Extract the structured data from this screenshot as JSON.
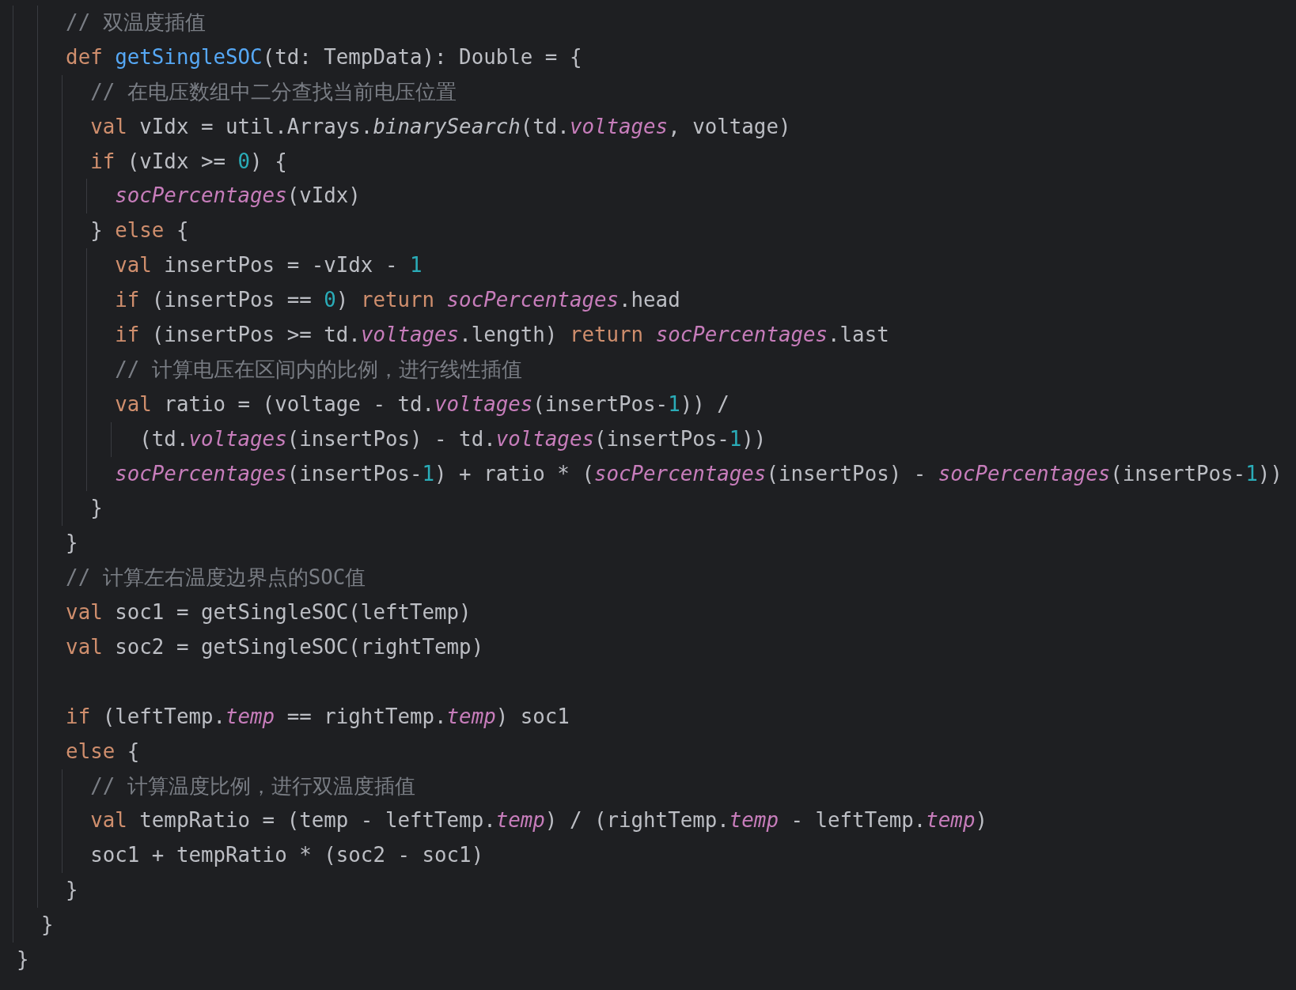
{
  "editor": {
    "lines": [
      {
        "kind": "code",
        "tokens": [
          {
            "text": "    // 双温度插值",
            "kind": "comment"
          }
        ]
      },
      {
        "kind": "code",
        "tokens": [
          {
            "text": "    def ",
            "kind": "keyword"
          },
          {
            "text": "getSingleSOC",
            "kind": "function"
          },
          {
            "text": "(td: TempData): Double = {",
            "kind": "plain"
          }
        ]
      },
      {
        "kind": "code",
        "tokens": [
          {
            "text": "      // 在电压数组中二分查找当前电压位置",
            "kind": "comment"
          }
        ]
      },
      {
        "kind": "code",
        "tokens": [
          {
            "text": "      val",
            "kind": "keyword"
          },
          {
            "text": " vIdx = util.Arrays.",
            "kind": "plain"
          },
          {
            "text": "binarySearch",
            "kind": "static"
          },
          {
            "text": "(td.",
            "kind": "plain"
          },
          {
            "text": "voltages",
            "kind": "field"
          },
          {
            "text": ", voltage)",
            "kind": "plain"
          }
        ]
      },
      {
        "kind": "code",
        "tokens": [
          {
            "text": "      if",
            "kind": "keyword"
          },
          {
            "text": " (vIdx >= ",
            "kind": "plain"
          },
          {
            "text": "0",
            "kind": "number"
          },
          {
            "text": ") {",
            "kind": "plain"
          }
        ]
      },
      {
        "kind": "code",
        "tokens": [
          {
            "text": "        socPercentages",
            "kind": "field"
          },
          {
            "text": "(vIdx)",
            "kind": "plain"
          }
        ]
      },
      {
        "kind": "code",
        "tokens": [
          {
            "text": "      } ",
            "kind": "plain"
          },
          {
            "text": "else",
            "kind": "keyword"
          },
          {
            "text": " {",
            "kind": "plain"
          }
        ]
      },
      {
        "kind": "code",
        "tokens": [
          {
            "text": "        val",
            "kind": "keyword"
          },
          {
            "text": " insertPos = -vIdx - ",
            "kind": "plain"
          },
          {
            "text": "1",
            "kind": "number"
          }
        ]
      },
      {
        "kind": "code",
        "tokens": [
          {
            "text": "        if",
            "kind": "keyword"
          },
          {
            "text": " (insertPos == ",
            "kind": "plain"
          },
          {
            "text": "0",
            "kind": "number"
          },
          {
            "text": ") ",
            "kind": "plain"
          },
          {
            "text": "return ",
            "kind": "keyword"
          },
          {
            "text": "socPercentages",
            "kind": "field"
          },
          {
            "text": ".head",
            "kind": "plain"
          }
        ]
      },
      {
        "kind": "code",
        "tokens": [
          {
            "text": "        if",
            "kind": "keyword"
          },
          {
            "text": " (insertPos >= td.",
            "kind": "plain"
          },
          {
            "text": "voltages",
            "kind": "field"
          },
          {
            "text": ".length) ",
            "kind": "plain"
          },
          {
            "text": "return ",
            "kind": "keyword"
          },
          {
            "text": "socPercentages",
            "kind": "field"
          },
          {
            "text": ".last",
            "kind": "plain"
          }
        ]
      },
      {
        "kind": "code",
        "tokens": [
          {
            "text": "        // 计算电压在区间内的比例，进行线性插值",
            "kind": "comment"
          }
        ]
      },
      {
        "kind": "code",
        "tokens": [
          {
            "text": "        val",
            "kind": "keyword"
          },
          {
            "text": " ratio = (voltage - td.",
            "kind": "plain"
          },
          {
            "text": "voltages",
            "kind": "field"
          },
          {
            "text": "(insertPos-",
            "kind": "plain"
          },
          {
            "text": "1",
            "kind": "number"
          },
          {
            "text": ")) /",
            "kind": "plain"
          }
        ]
      },
      {
        "kind": "code",
        "tokens": [
          {
            "text": "          (td.",
            "kind": "plain"
          },
          {
            "text": "voltages",
            "kind": "field"
          },
          {
            "text": "(insertPos) - td.",
            "kind": "plain"
          },
          {
            "text": "voltages",
            "kind": "field"
          },
          {
            "text": "(insertPos-",
            "kind": "plain"
          },
          {
            "text": "1",
            "kind": "number"
          },
          {
            "text": "))",
            "kind": "plain"
          }
        ]
      },
      {
        "kind": "code",
        "tokens": [
          {
            "text": "        socPercentages",
            "kind": "field"
          },
          {
            "text": "(insertPos-",
            "kind": "plain"
          },
          {
            "text": "1",
            "kind": "number"
          },
          {
            "text": ") + ratio * (",
            "kind": "plain"
          },
          {
            "text": "socPercentages",
            "kind": "field"
          },
          {
            "text": "(insertPos) - ",
            "kind": "plain"
          },
          {
            "text": "socPercentages",
            "kind": "field"
          },
          {
            "text": "(insertPos-",
            "kind": "plain"
          },
          {
            "text": "1",
            "kind": "number"
          },
          {
            "text": "))",
            "kind": "plain"
          }
        ]
      },
      {
        "kind": "code",
        "tokens": [
          {
            "text": "      }",
            "kind": "plain"
          }
        ]
      },
      {
        "kind": "code",
        "tokens": [
          {
            "text": "    }",
            "kind": "plain"
          }
        ]
      },
      {
        "kind": "code",
        "tokens": [
          {
            "text": "    // 计算左右温度边界点的SOC值",
            "kind": "comment"
          }
        ]
      },
      {
        "kind": "code",
        "tokens": [
          {
            "text": "    val",
            "kind": "keyword"
          },
          {
            "text": " soc1 = getSingleSOC(leftTemp)",
            "kind": "plain"
          }
        ]
      },
      {
        "kind": "code",
        "tokens": [
          {
            "text": "    val",
            "kind": "keyword"
          },
          {
            "text": " soc2 = getSingleSOC(rightTemp)",
            "kind": "plain"
          }
        ]
      },
      {
        "kind": "blank"
      },
      {
        "kind": "code",
        "tokens": [
          {
            "text": "    if",
            "kind": "keyword"
          },
          {
            "text": " (leftTemp.",
            "kind": "plain"
          },
          {
            "text": "temp",
            "kind": "field"
          },
          {
            "text": " == rightTemp.",
            "kind": "plain"
          },
          {
            "text": "temp",
            "kind": "field"
          },
          {
            "text": ") soc1",
            "kind": "plain"
          }
        ]
      },
      {
        "kind": "code",
        "tokens": [
          {
            "text": "    else",
            "kind": "keyword"
          },
          {
            "text": " {",
            "kind": "plain"
          }
        ]
      },
      {
        "kind": "code",
        "tokens": [
          {
            "text": "      // 计算温度比例，进行双温度插值",
            "kind": "comment"
          }
        ]
      },
      {
        "kind": "code",
        "tokens": [
          {
            "text": "      val",
            "kind": "keyword"
          },
          {
            "text": " tempRatio = (temp - leftTemp.",
            "kind": "plain"
          },
          {
            "text": "temp",
            "kind": "field"
          },
          {
            "text": ") / (rightTemp.",
            "kind": "plain"
          },
          {
            "text": "temp",
            "kind": "field"
          },
          {
            "text": " - leftTemp.",
            "kind": "plain"
          },
          {
            "text": "temp",
            "kind": "field"
          },
          {
            "text": ")",
            "kind": "plain"
          }
        ]
      },
      {
        "kind": "code",
        "tokens": [
          {
            "text": "      soc1 + tempRatio * (soc2 - soc1)",
            "kind": "plain"
          }
        ]
      },
      {
        "kind": "code",
        "tokens": [
          {
            "text": "    }",
            "kind": "plain"
          }
        ]
      },
      {
        "kind": "code",
        "tokens": [
          {
            "text": "  }",
            "kind": "plain"
          }
        ]
      },
      {
        "kind": "code",
        "tokens": [
          {
            "text": "}",
            "kind": "plain"
          }
        ]
      }
    ]
  }
}
